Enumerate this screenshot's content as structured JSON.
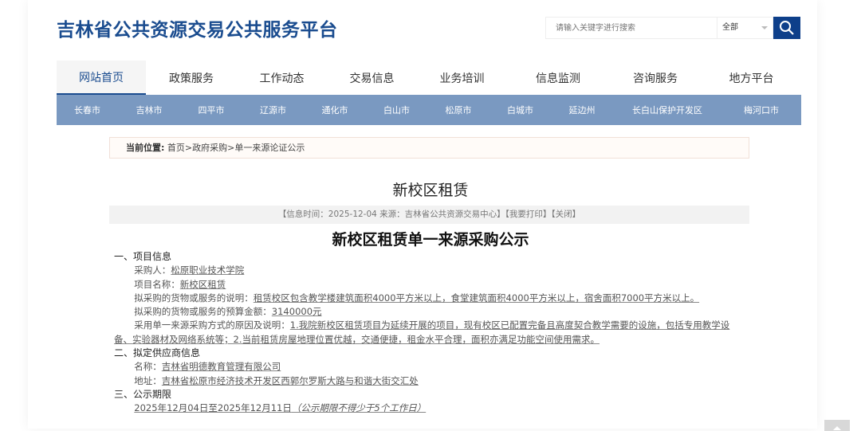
{
  "header": {
    "logo": "吉林省公共资源交易公共服务平台",
    "search_placeholder": "请输入关键字进行搜索",
    "search_scope": "全部"
  },
  "nav": [
    "网站首页",
    "政策服务",
    "工作动态",
    "交易信息",
    "业务培训",
    "信息监测",
    "咨询服务",
    "地方平台"
  ],
  "cities": [
    "长春市",
    "吉林市",
    "四平市",
    "辽源市",
    "通化市",
    "白山市",
    "松原市",
    "白城市",
    "延边州",
    "长白山保护开发区",
    "梅河口市"
  ],
  "breadcrumb": {
    "label": "当前位置:",
    "path": "首页>政府采购>单一来源论证公示"
  },
  "article": {
    "title": "新校区租赁",
    "info": "【信息时间：2025-12-04 来源：吉林省公共资源交易中心】【我要打印】【关闭】",
    "heading": "新校区租赁单一来源采购公示",
    "sec1": "一、项目信息",
    "buyer_label": "采购人：",
    "buyer": "松原职业技术学院",
    "project_label": "项目名称：",
    "project": "新校区租赁",
    "desc_label": "拟采购的货物或服务的说明：",
    "desc": "租赁校区包含教学楼建筑面积4000平方米以上，食堂建筑面积4000平方米以上，宿舍面积7000平方米以上。",
    "budget_label": "拟采购的货物或服务的预算金额：",
    "budget": "3140000元",
    "reason_label": "采用单一来源采购方式的原因及说明：",
    "reason": "1.我院新校区租赁项目为延续开展的项目，现有校区已配置完备且高度契合教学需要的设施，包括专用教学设备、实验器材及网络系统等；2.当前租赁房屋地理位置优越，交通便捷，租金水平合理，面积亦满足功能空间使用需求。",
    "sec2": "二、拟定供应商信息",
    "name_label": "名称：",
    "name": "吉林省明德教育管理有限公司",
    "addr_label": "地址：",
    "addr": "吉林省松原市经济技术开发区西郭尔罗斯大路与和谐大街交汇处",
    "sec3": "三、公示期限",
    "period": "2025年12月04日至2025年12月11日",
    "period_note": "（公示期限不得少于5个工作日）"
  },
  "colors": {
    "brand": "#1a4c8f",
    "city_bar": "#7a99c1",
    "search_button": "#0e3f8a"
  }
}
